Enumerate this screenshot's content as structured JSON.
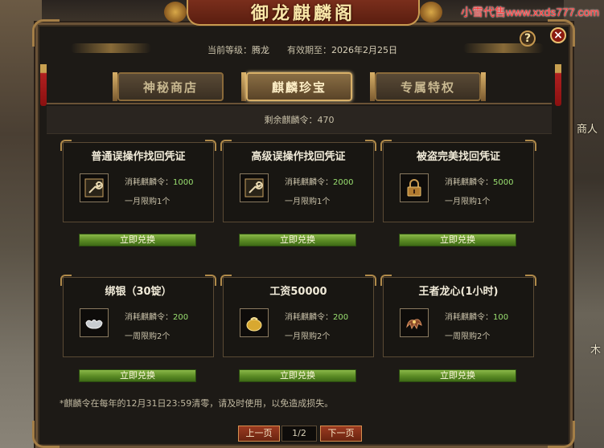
{
  "watermark": "小雪代售www.xxds777.com",
  "world": {
    "npc_label": "商人",
    "npc_label2": "木"
  },
  "window": {
    "title": "御龙麒麟阁",
    "help": "?",
    "close": "×"
  },
  "header": {
    "level_label": "当前等级：",
    "level_value": "腾龙",
    "expiry_label": "有效期至：",
    "expiry_value": "2026年2月25日"
  },
  "tabs": [
    {
      "label": "神秘商店",
      "active": false
    },
    {
      "label": "麒麟珍宝",
      "active": true
    },
    {
      "label": "专属特权",
      "active": false
    }
  ],
  "remain": {
    "label": "剩余麒麟令：",
    "value": "470"
  },
  "items": [
    {
      "title": "普通误操作找回凭证",
      "cost_label": "消耗麒麟令：",
      "cost": "1000",
      "limit": "一月限购1个",
      "icon": "wrench-icon",
      "button": "立即兑换"
    },
    {
      "title": "高级误操作找回凭证",
      "cost_label": "消耗麒麟令：",
      "cost": "2000",
      "limit": "一月限购1个",
      "icon": "wrench-icon",
      "button": "立即兑换"
    },
    {
      "title": "被盗完美找回凭证",
      "cost_label": "消耗麒麟令：",
      "cost": "5000",
      "limit": "一月限购1个",
      "icon": "padlock-icon",
      "button": "立即兑换"
    },
    {
      "title": "绑银（30锭）",
      "cost_label": "消耗麒麟令：",
      "cost": "200",
      "limit": "一周限购2个",
      "icon": "silver-ingot-icon",
      "button": "立即兑换"
    },
    {
      "title": "工资50000",
      "cost_label": "消耗麒麟令：",
      "cost": "200",
      "limit": "一月限购2个",
      "icon": "gold-bag-icon",
      "button": "立即兑换"
    },
    {
      "title": "王者龙心(1小时)",
      "cost_label": "消耗麒麟令：",
      "cost": "100",
      "limit": "一周限购2个",
      "icon": "dragon-heart-icon",
      "button": "立即兑换"
    }
  ],
  "footnote": "*麒麟令在每年的12月31日23:59清零，请及时使用，以免造成损失。",
  "pager": {
    "prev": "上一页",
    "page": "1/2",
    "next": "下一页"
  },
  "colors": {
    "accent_gold": "#c89a50",
    "cost_green": "#9ae070",
    "button_green": "#5a8a24",
    "pager_red": "#9a3a20"
  }
}
